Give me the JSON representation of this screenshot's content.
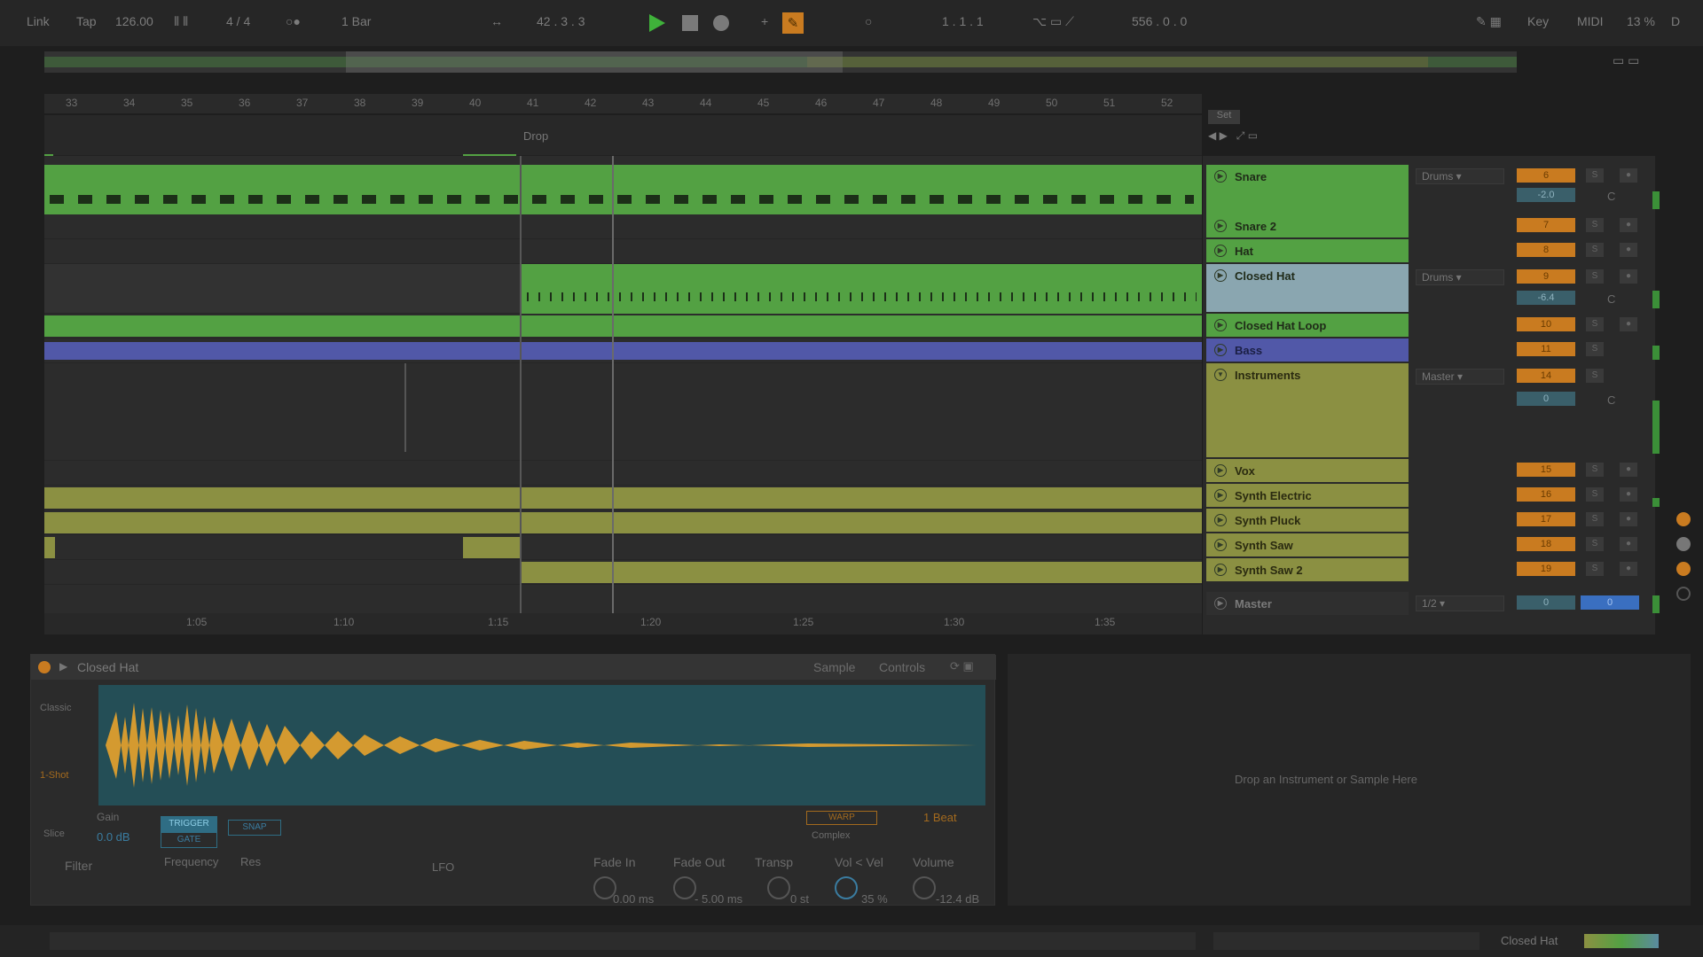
{
  "transport": {
    "link": "Link",
    "tap": "Tap",
    "tempo": "126.00",
    "signature": "4 / 4",
    "quantize": "1 Bar",
    "position": "42 . 3 . 3",
    "loop_start": "1 . 1 . 1",
    "loop_length": "556 . 0 . 0",
    "key": "Key",
    "midi": "MIDI",
    "cpu": "13 %",
    "disk": "D"
  },
  "ruler": [
    "33",
    "34",
    "35",
    "36",
    "37",
    "38",
    "39",
    "40",
    "41",
    "42",
    "43",
    "44",
    "45",
    "46",
    "47",
    "48",
    "49",
    "50",
    "51",
    "52"
  ],
  "locator": "Drop",
  "set_button": "Set",
  "time_ruler": [
    "1:05",
    "1:10",
    "1:15",
    "1:20",
    "1:25",
    "1:30",
    "1:35"
  ],
  "tracks": [
    {
      "name": "Snare",
      "num": "6",
      "io": "Drums",
      "vol": "-2.0",
      "pan": "C"
    },
    {
      "name": "Snare 2",
      "num": "7"
    },
    {
      "name": "Hat",
      "num": "8"
    },
    {
      "name": "Closed Hat",
      "num": "9",
      "io": "Drums",
      "vol": "-6.4",
      "pan": "C"
    },
    {
      "name": "Closed Hat Loop",
      "num": "10"
    },
    {
      "name": "Bass",
      "num": "11"
    },
    {
      "name": "Instruments",
      "num": "14",
      "io": "Master",
      "vol": "0",
      "pan": "C"
    },
    {
      "name": "Vox",
      "num": "15"
    },
    {
      "name": "Synth Electric",
      "num": "16"
    },
    {
      "name": "Synth Pluck",
      "num": "17"
    },
    {
      "name": "Synth Saw",
      "num": "18"
    },
    {
      "name": "Synth Saw 2",
      "num": "19"
    }
  ],
  "master": {
    "name": "Master",
    "cue": "1/2",
    "vol": "0",
    "pan": "0"
  },
  "device": {
    "title": "Closed Hat",
    "tab_sample": "Sample",
    "tab_controls": "Controls",
    "mode_classic": "Classic",
    "mode_oneshot": "1-Shot",
    "mode_slice": "Slice",
    "gain_label": "Gain",
    "gain_value": "0.0 dB",
    "trigger": "TRIGGER",
    "gate": "GATE",
    "snap": "SNAP",
    "warp": "WARP",
    "beat": "1 Beat",
    "complex": "Complex",
    "filter": "Filter",
    "frequency": "Frequency",
    "res": "Res",
    "lfo": "LFO",
    "fade_in": "Fade In",
    "fade_in_val": "0.00 ms",
    "fade_out": "Fade Out",
    "fade_out_val": "- 5.00 ms",
    "transp": "Transp",
    "transp_val": "0 st",
    "vol_vel": "Vol < Vel",
    "vol_vel_val": "35 %",
    "volume": "Volume",
    "volume_val": "-12.4 dB"
  },
  "dropzone": "Drop an Instrument or Sample Here",
  "status": {
    "track": "Closed Hat"
  },
  "colors": {
    "green": "#53a143",
    "olive": "#8b9042",
    "blue": "#5158a8",
    "orange": "#c97b20",
    "play": "#3fb23a",
    "wave": "#d49a30"
  }
}
